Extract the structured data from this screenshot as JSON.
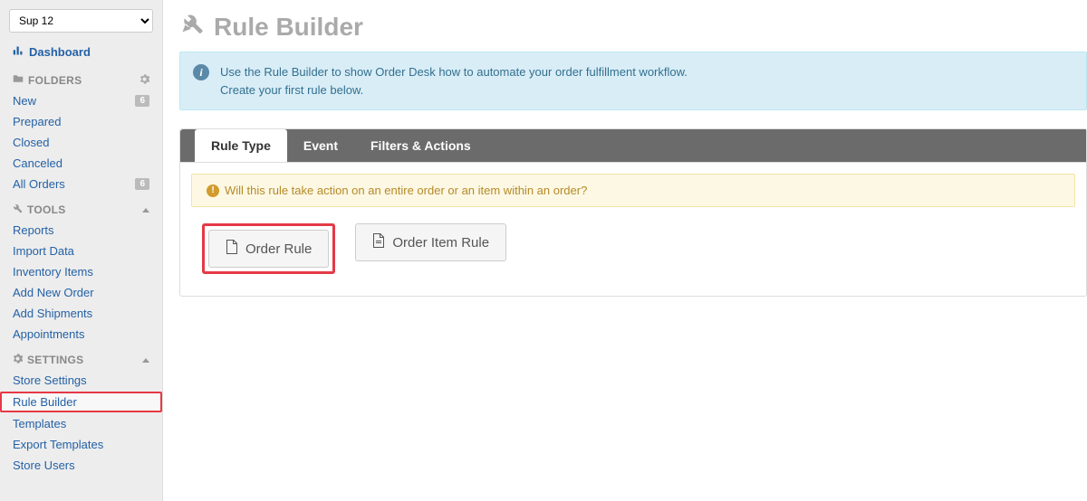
{
  "store_selector": {
    "value": "Sup 12"
  },
  "dashboard": {
    "label": "Dashboard"
  },
  "folders": {
    "header": "FOLDERS",
    "items": [
      {
        "label": "New",
        "count": "6"
      },
      {
        "label": "Prepared",
        "count": ""
      },
      {
        "label": "Closed",
        "count": ""
      },
      {
        "label": "Canceled",
        "count": ""
      },
      {
        "label": "All Orders",
        "count": "6"
      }
    ]
  },
  "tools": {
    "header": "TOOLS",
    "items": [
      {
        "label": "Reports"
      },
      {
        "label": "Import Data"
      },
      {
        "label": "Inventory Items"
      },
      {
        "label": "Add New Order"
      },
      {
        "label": "Add Shipments"
      },
      {
        "label": "Appointments"
      }
    ]
  },
  "settings": {
    "header": "SETTINGS",
    "items": [
      {
        "label": "Store Settings"
      },
      {
        "label": "Rule Builder"
      },
      {
        "label": "Templates"
      },
      {
        "label": "Export Templates"
      },
      {
        "label": "Store Users"
      }
    ]
  },
  "page_title": "Rule Builder",
  "info_box": {
    "line1": "Use the Rule Builder to show Order Desk how to automate your order fulfillment workflow.",
    "line2": "Create your first rule below."
  },
  "tabs": {
    "rule_type": "Rule Type",
    "event": "Event",
    "filters_actions": "Filters & Actions"
  },
  "warn_text": "Will this rule take action on an entire order or an item within an order?",
  "buttons": {
    "order_rule": "Order Rule",
    "order_item_rule": "Order Item Rule"
  }
}
